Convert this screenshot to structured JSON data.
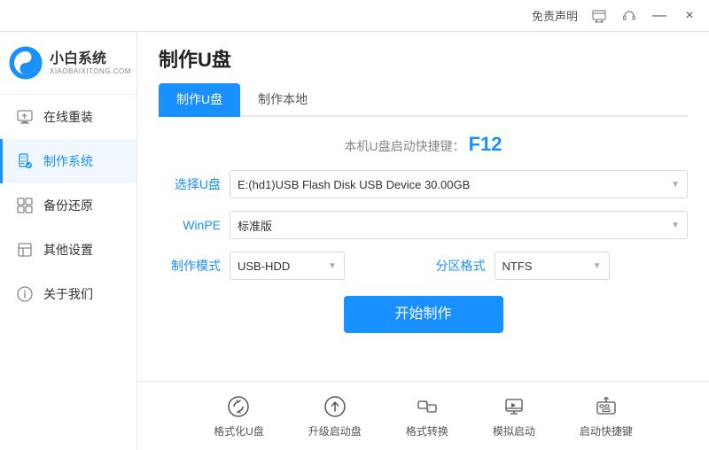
{
  "titlebar": {
    "notice_label": "免责声明",
    "min_icon": "—",
    "close_icon": "×"
  },
  "logo": {
    "title": "小白系统",
    "subtitle": "XIAOBAIXITONG.COM"
  },
  "nav": {
    "items": [
      {
        "id": "online-reinstall",
        "label": "在线重装",
        "active": false
      },
      {
        "id": "make-system",
        "label": "制作系统",
        "active": true
      },
      {
        "id": "backup-restore",
        "label": "备份还原",
        "active": false
      },
      {
        "id": "other-settings",
        "label": "其他设置",
        "active": false
      },
      {
        "id": "about-us",
        "label": "关于我们",
        "active": false
      }
    ]
  },
  "content": {
    "title": "制作U盘",
    "tabs": [
      {
        "id": "make-usb",
        "label": "制作U盘",
        "active": true
      },
      {
        "id": "make-local",
        "label": "制作本地",
        "active": false
      }
    ],
    "shortcut": {
      "prefix": "本机U盘启动快捷键：",
      "key": "F12"
    },
    "form": {
      "usb_label": "选择U盘",
      "usb_value": "E:(hd1)USB Flash Disk USB Device 30.00GB",
      "winpe_label": "WinPE",
      "winpe_value": "标准版",
      "mode_label": "制作模式",
      "mode_value": "USB-HDD",
      "partition_label": "分区格式",
      "partition_value": "NTFS"
    },
    "start_button": "开始制作"
  },
  "bottom_toolbar": {
    "items": [
      {
        "id": "format-usb",
        "label": "格式化U盘"
      },
      {
        "id": "upgrade-boot",
        "label": "升级启动盘"
      },
      {
        "id": "format-convert",
        "label": "格式转换"
      },
      {
        "id": "simulate-boot",
        "label": "模拟启动"
      },
      {
        "id": "shortcut-key",
        "label": "启动快捷键"
      }
    ]
  }
}
